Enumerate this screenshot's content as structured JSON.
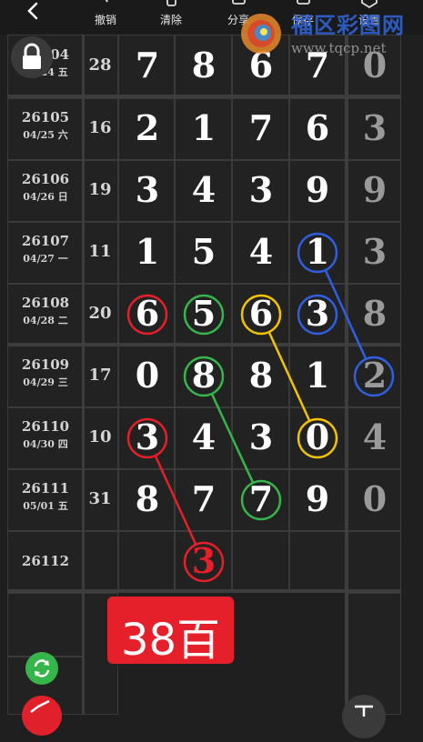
{
  "toolbar": {
    "undo_label": "撤销",
    "clear_label": "清除",
    "share_label": "分享",
    "save_label": "保存",
    "settings_label": "设置"
  },
  "watermark": {
    "title": "福区彩图网",
    "url": "www.tqcp.net"
  },
  "rows": [
    {
      "issue": "26104",
      "date": "04/24 五",
      "sum": "28",
      "digits": [
        "7",
        "8",
        "6",
        "7"
      ],
      "side": "0"
    },
    {
      "issue": "26105",
      "date": "04/25 六",
      "sum": "16",
      "digits": [
        "2",
        "1",
        "7",
        "6"
      ],
      "side": "3"
    },
    {
      "issue": "26106",
      "date": "04/26 日",
      "sum": "19",
      "digits": [
        "3",
        "4",
        "3",
        "9"
      ],
      "side": "9"
    },
    {
      "issue": "26107",
      "date": "04/27 一",
      "sum": "11",
      "digits": [
        "1",
        "5",
        "4",
        "1"
      ],
      "side": "3"
    },
    {
      "issue": "26108",
      "date": "04/28 二",
      "sum": "20",
      "digits": [
        "6",
        "5",
        "6",
        "3"
      ],
      "side": "8"
    },
    {
      "issue": "26109",
      "date": "04/29 三",
      "sum": "17",
      "digits": [
        "0",
        "8",
        "8",
        "1"
      ],
      "side": "2"
    },
    {
      "issue": "26110",
      "date": "04/30 四",
      "sum": "10",
      "digits": [
        "3",
        "4",
        "3",
        "0"
      ],
      "side": "4"
    },
    {
      "issue": "26111",
      "date": "05/01 五",
      "sum": "31",
      "digits": [
        "8",
        "7",
        "7",
        "9"
      ],
      "side": "0"
    }
  ],
  "next_row": {
    "issue": "26112",
    "predicted_digit": "3"
  },
  "badge": {
    "text": "38百"
  },
  "colors": {
    "red": "#e5202a",
    "green": "#36b54a",
    "yellow": "#f2c300",
    "blue": "#2f5fe0",
    "background": "#1f1f1f"
  },
  "icons": [
    "back-arrow-icon",
    "undo-icon",
    "clear-icon",
    "share-icon",
    "save-icon",
    "settings-icon",
    "lock-icon",
    "refresh-icon",
    "pen-icon",
    "text-tool-icon"
  ]
}
